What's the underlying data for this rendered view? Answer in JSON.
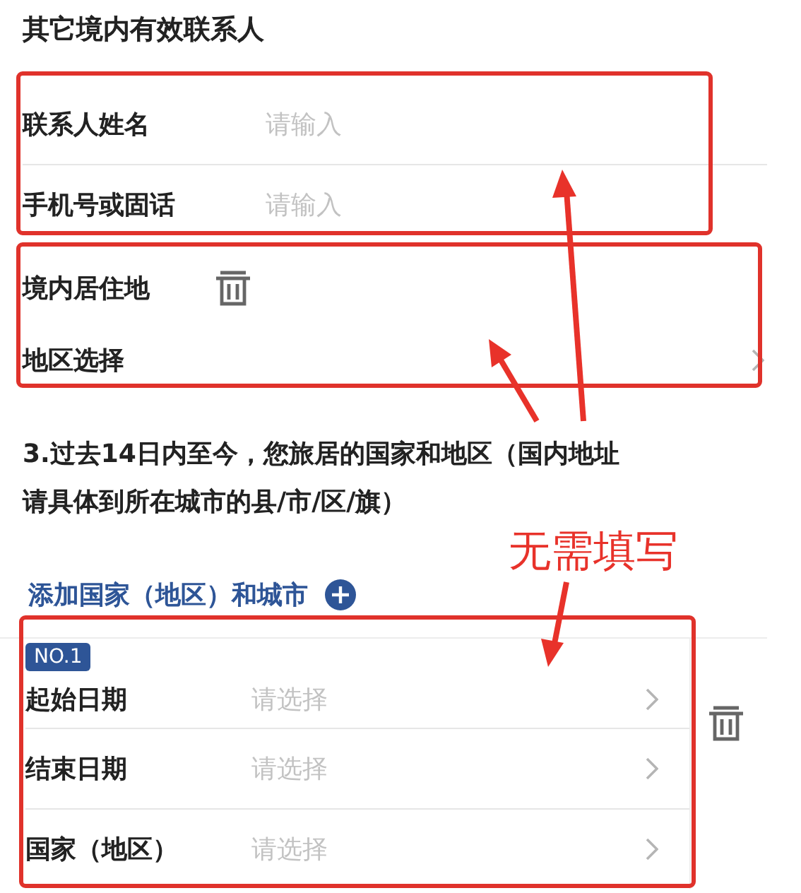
{
  "section_title": "其它境内有效联系人",
  "contact_fields": [
    {
      "label": "联系人姓名",
      "placeholder": "请输入"
    },
    {
      "label": "手机号或固话",
      "placeholder": "请输入"
    }
  ],
  "residence": {
    "label": "境内居住地",
    "region_label": "地区选择"
  },
  "question": "3.过去14日内至今，您旅居的国家和地区（国内地址请具体到所在城市的县/市/区/旗）",
  "add_link": "添加国家（地区）和城市",
  "trips": [
    {
      "badge": "NO.1",
      "fields": [
        {
          "label": "起始日期",
          "placeholder": "请选择"
        },
        {
          "label": "结束日期",
          "placeholder": "请选择"
        },
        {
          "label": "国家（地区）",
          "placeholder": "请选择"
        }
      ]
    }
  ],
  "annotation": "无需填写"
}
